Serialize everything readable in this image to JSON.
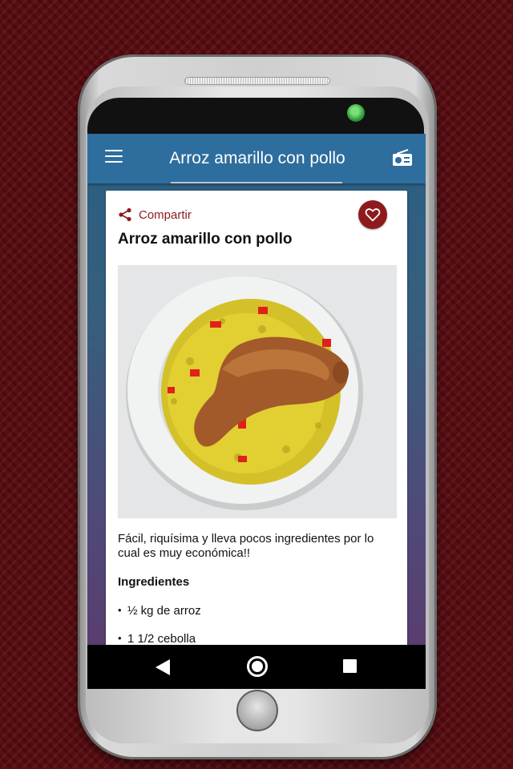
{
  "appbar": {
    "title": "Arroz amarillo con pollo",
    "menu_icon": "hamburger-menu-icon",
    "radio_icon": "radio-icon"
  },
  "recipe": {
    "share_label": "Compartir",
    "share_icon": "share-icon",
    "favorite_icon": "heart-icon",
    "title": "Arroz amarillo con pollo",
    "description": "Fácil, riquísima y lleva pocos ingredientes por lo cual es muy económica!!",
    "ingredients_heading": "Ingredientes",
    "ingredients": [
      "½ kg de arroz",
      "1 1/2 cebolla"
    ]
  },
  "navbar": {
    "back_icon": "back-triangle-icon",
    "home_icon": "home-circle-icon",
    "recent_icon": "recent-apps-square-icon"
  },
  "colors": {
    "appbar": "#2e6e9e",
    "accent": "#8e1a1e",
    "background": "#5a0d12"
  }
}
